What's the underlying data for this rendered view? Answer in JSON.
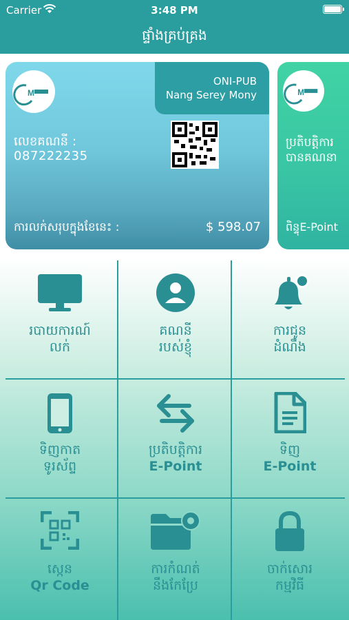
{
  "status": {
    "carrier": "Carrier",
    "time": "3:48 PM"
  },
  "nav": {
    "title": "ផ្ទាំងគ្រប់គ្រង"
  },
  "card": {
    "tag_line1": "ONI-PUB",
    "tag_line2": "Nang Serey Mony",
    "account_label": "លេខគណនី :",
    "account_number": "087222235",
    "sales_label": "ការលក់សរុបក្នុងខែនេះ :",
    "sales_value": "$ 598.07"
  },
  "card2": {
    "line1": "ប្រតិបត្តិការ",
    "line2": "បានគណនា",
    "line3": "ពិន្ទុE-Point"
  },
  "menu": [
    {
      "line1": "របាយការណ៍",
      "line2": "លក់",
      "icon": "monitor-icon"
    },
    {
      "line1": "គណនី",
      "line2": "របស់ខ្ញុំ",
      "icon": "user-icon"
    },
    {
      "line1": "ការជូន",
      "line2": "ដំណឹង",
      "icon": "bell-icon"
    },
    {
      "line1": "ទិញកាត",
      "line2": "ទូរស័ព្ទ",
      "icon": "phone-icon"
    },
    {
      "line1": "ប្រតិបត្តិការ",
      "line2": "E-Point",
      "icon": "swap-icon"
    },
    {
      "line1": "ទិញ",
      "line2": "E-Point",
      "icon": "document-icon"
    },
    {
      "line1": "ស្កេន",
      "line2": "Qr Code",
      "icon": "qr-scan-icon"
    },
    {
      "line1": "ការកំណត់",
      "line2": "នឹងកែប្រែ",
      "icon": "folder-settings-icon"
    },
    {
      "line1": "ចាក់សោរ",
      "line2": "កម្មវិធី",
      "icon": "lock-icon"
    }
  ],
  "colors": {
    "teal": "#2a9e9e",
    "icon": "#2a8f93"
  }
}
